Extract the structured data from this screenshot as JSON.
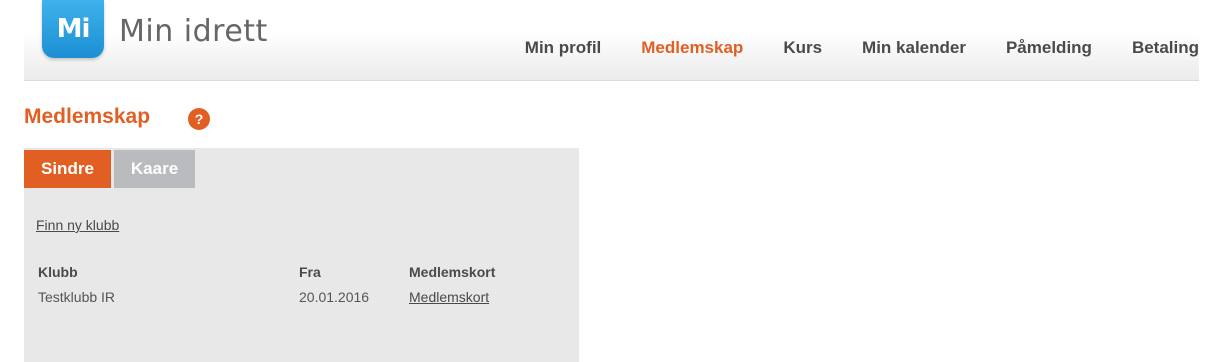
{
  "header": {
    "logo_mark": "Mi",
    "logo_text": "Min idrett",
    "nav": [
      {
        "label": "Min profil",
        "active": false
      },
      {
        "label": "Medlemskap",
        "active": true
      },
      {
        "label": "Kurs",
        "active": false
      },
      {
        "label": "Min kalender",
        "active": false
      },
      {
        "label": "Påmelding",
        "active": false
      },
      {
        "label": "Betaling",
        "active": false
      }
    ]
  },
  "main": {
    "title": "Medlemskap",
    "help_icon": "?",
    "tabs": [
      {
        "label": "Sindre",
        "active": true
      },
      {
        "label": "Kaare",
        "active": false
      }
    ],
    "find_club_link": "Finn ny klubb",
    "table": {
      "headers": [
        "Klubb",
        "Fra",
        "Medlemskort"
      ],
      "rows": [
        {
          "club": "Testklubb IR",
          "from": "20.01.2016",
          "card": "Medlemskort"
        }
      ]
    }
  },
  "colors": {
    "accent": "#e25f24",
    "logo_blue": "#1b8fd3",
    "panel_bg": "#e8e8e8",
    "tab_inactive": "#b9bbbe"
  }
}
